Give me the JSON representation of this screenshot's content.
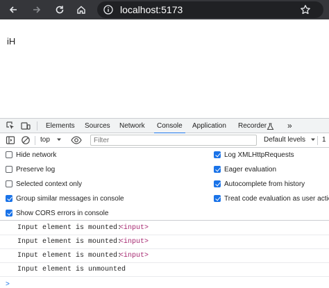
{
  "browser": {
    "url": "localhost:5173",
    "colors": {
      "toolbar": "#35363a",
      "omnibox": "#202124"
    }
  },
  "page": {
    "text": "iH"
  },
  "devtools": {
    "tabs": [
      "Elements",
      "Sources",
      "Network",
      "Console",
      "Application",
      "Recorder"
    ],
    "active_tab": "Console",
    "more_tabs": "»",
    "context": "top",
    "filter_placeholder": "Filter",
    "levels": "Default levels",
    "issues_count": "1",
    "settings_left": [
      {
        "label": "Hide network",
        "checked": false
      },
      {
        "label": "Preserve log",
        "checked": false
      },
      {
        "label": "Selected context only",
        "checked": false
      },
      {
        "label": "Group similar messages in console",
        "checked": true
      },
      {
        "label": "Show CORS errors in console",
        "checked": true
      }
    ],
    "settings_right": [
      {
        "label": "Log XMLHttpRequests",
        "checked": true
      },
      {
        "label": "Eager evaluation",
        "checked": true
      },
      {
        "label": "Autocomplete from history",
        "checked": true
      },
      {
        "label": "Treat code evaluation as user action",
        "checked": true
      }
    ],
    "messages": [
      {
        "text": "Input element is mounted:",
        "tag": "<input>"
      },
      {
        "text": "Input element is mounted:",
        "tag": "<input>"
      },
      {
        "text": "Input element is mounted:",
        "tag": "<input>"
      },
      {
        "text": "Input element is unmounted",
        "tag": ""
      }
    ],
    "prompt": ">"
  },
  "icons": [
    "back-arrow-icon",
    "forward-arrow-icon",
    "reload-icon",
    "home-icon",
    "site-info-icon",
    "bookmark-star-icon",
    "inspect-element-icon",
    "device-toolbar-icon",
    "recorder-flask-icon",
    "sidebar-toggle-icon",
    "clear-console-icon",
    "eye-icon",
    "dropdown-caret-icon"
  ],
  "accent": "#1a73e8"
}
